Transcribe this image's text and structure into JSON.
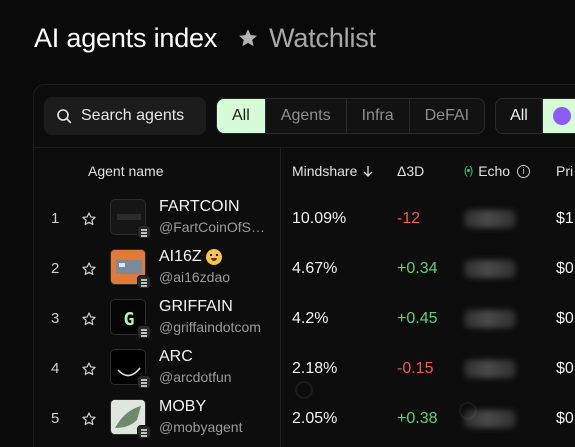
{
  "header": {
    "title": "AI agents index",
    "watchlist_label": "Watchlist"
  },
  "toolbar": {
    "search_placeholder": "Search agents",
    "filters": [
      "All",
      "Agents",
      "Infra",
      "DeFAI"
    ],
    "active_filter": "All",
    "secondary_filter": "All"
  },
  "columns": {
    "agent_name": "Agent name",
    "mindshare": "Mindshare",
    "delta_3d": "Δ3D",
    "echo": "Echo",
    "price": "Pri"
  },
  "rows": [
    {
      "rank": "1",
      "name": "FARTCOIN",
      "handle": "@FartCoinOfSolana",
      "mindshare": "10.09%",
      "delta": "-12",
      "price": "$1"
    },
    {
      "rank": "2",
      "name": "AI16Z",
      "handle": "@ai16zdao",
      "mindshare": "4.67%",
      "delta": "+0.34",
      "price": "$0"
    },
    {
      "rank": "3",
      "name": "GRIFFAIN",
      "handle": "@griffaindotcom",
      "mindshare": "4.2%",
      "delta": "+0.45",
      "price": "$0"
    },
    {
      "rank": "4",
      "name": "ARC",
      "handle": "@arcdotfun",
      "mindshare": "2.18%",
      "delta": "-0.15",
      "price": "$0"
    },
    {
      "rank": "5",
      "name": "MOBY",
      "handle": "@mobyagent",
      "mindshare": "2.05%",
      "delta": "+0.38",
      "price": "$0"
    }
  ],
  "colors": {
    "accent_green": "#d7fbd6",
    "negative": "#ef5a5a",
    "positive": "#5fd37a"
  }
}
